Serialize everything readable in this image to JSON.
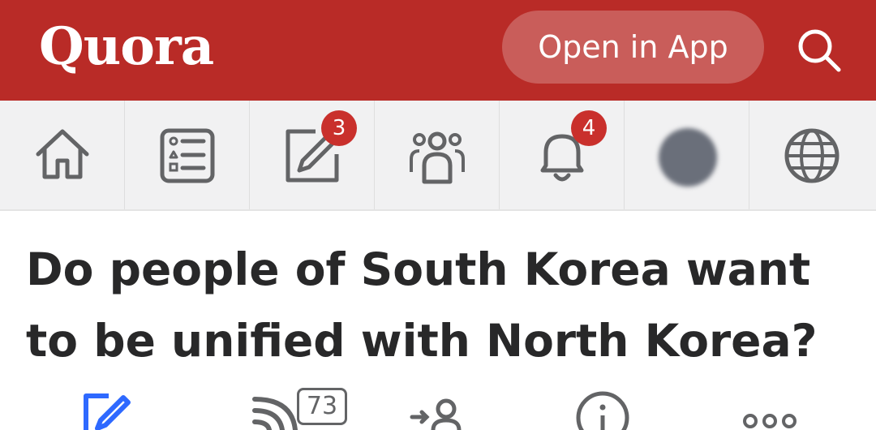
{
  "header": {
    "logo_text": "Quora",
    "open_in_app_label": "Open in App",
    "search_icon": "search-icon",
    "background_color": "#b92b27"
  },
  "nav": {
    "tabs": [
      {
        "name": "home",
        "icon": "home-icon"
      },
      {
        "name": "following",
        "icon": "list-icon"
      },
      {
        "name": "answer",
        "icon": "pencil-icon",
        "badge": "3"
      },
      {
        "name": "spaces",
        "icon": "people-icon"
      },
      {
        "name": "notifications",
        "icon": "bell-icon",
        "badge": "4"
      },
      {
        "name": "profile",
        "icon": "avatar"
      },
      {
        "name": "languages",
        "icon": "globe-icon"
      }
    ]
  },
  "question": {
    "title": "Do people of South Korea want to be unified with North Korea?"
  },
  "actions": {
    "follow_count": "73",
    "items": [
      "answer-icon",
      "follow-icon",
      "request-icon",
      "info-icon",
      "more-icon"
    ]
  },
  "colors": {
    "brand": "#b92b27",
    "badge": "#c9302c",
    "icon": "#636466",
    "answer_accent": "#2e69ff",
    "text": "#282829"
  }
}
